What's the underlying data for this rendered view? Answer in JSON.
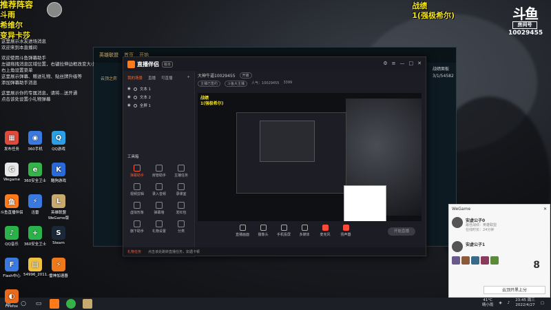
{
  "overlay": {
    "title": "推荐阵容",
    "lines": [
      "斗雨",
      "希维尔",
      "变异卡莎"
    ],
    "top_right": [
      "战绩",
      "1(强极希尔)"
    ]
  },
  "douyu": {
    "logo": "斗鱼",
    "sub": "房间号",
    "room_id": "10029455"
  },
  "chat": [
    "这里展示水友进场消息",
    "欢迎来到本直播间",
    "欢迎使用斗鱼弹幕助手",
    "左键拖拽消息区域位置，右键拉伸边框改变大小",
    "右上角设置菜单",
    "这里展示弹幕、赠送礼物、贴丝牌升级等",
    "添加弹幕助手消息",
    "这里展示你的专属消息，请将...送开通",
    "点击该处设置小礼物弹幕"
  ],
  "desktop_icons": [
    {
      "label": "发布任务",
      "color": "#e04a3a",
      "glyph": "▦"
    },
    {
      "label": "360手机",
      "color": "#3a7ae0",
      "glyph": "◉"
    },
    {
      "label": "QQ游戏",
      "color": "#2aa0e8",
      "glyph": "Q"
    },
    {
      "label": "Wegame",
      "color": "#e8e8e8",
      "glyph": "G"
    },
    {
      "label": "360安全卫士",
      "color": "#35b24a",
      "glyph": "e"
    },
    {
      "label": "酷狗游戏",
      "color": "#2a6ad8",
      "glyph": "K"
    },
    {
      "label": "斗鱼直播伴侣",
      "color": "#ff7a1a",
      "glyph": "鱼"
    },
    {
      "label": "迅雷",
      "color": "#3a7ae0",
      "glyph": "⚡"
    },
    {
      "label": "英雄联盟WeGame版",
      "color": "#c8aa6e",
      "glyph": "L"
    },
    {
      "label": "QQ音乐",
      "color": "#2ab34a",
      "glyph": "♪"
    },
    {
      "label": "360安全卫士",
      "color": "#2ab34a",
      "glyph": "+"
    },
    {
      "label": "Steam",
      "color": "#1b2838",
      "glyph": "S"
    },
    {
      "label": "Flash中心",
      "color": "#3a7ae0",
      "glyph": "F"
    },
    {
      "label": "54996_2011...",
      "color": "#f0c040",
      "glyph": "▤"
    },
    {
      "label": "雷神加速器",
      "color": "#f07a1a",
      "glyph": "⚡"
    },
    {
      "label": "Firefox",
      "color": "#e86a1a",
      "glyph": "◐"
    }
  ],
  "app": {
    "name": "直播伴侣",
    "version": "版本",
    "tabs": [
      "我的场景",
      "直播",
      "可直播"
    ],
    "scenes": [
      "文本 1",
      "文本 2",
      "全屏 1"
    ],
    "tools_title": "工具箱",
    "tools": [
      "弹幕助手",
      "房管助手",
      "主播任务",
      "视频剪辑",
      "录入音频",
      "录课室",
      "虚拟形象",
      "弹幕墙",
      "发红包",
      "旗下助手",
      "礼物设置",
      "分类"
    ],
    "stream_title": "大神牛逼10029455",
    "stream_tag": "开播",
    "stream_sub": [
      "主播已签约",
      "斗鱼大主播",
      "人气：10029455",
      "3399"
    ],
    "bottom_buttons": [
      "直播画面",
      "摄像头",
      "手机投屏",
      "多媒体",
      "麦克风",
      "扬声器"
    ],
    "start_label": "开始直播",
    "status": [
      "礼物任务",
      "点击该处跳转直播任务，如遇卡顿"
    ]
  },
  "preview": {
    "overlay": [
      "战绩",
      "1(强极希尔)"
    ]
  },
  "lol": {
    "tabs": [
      "英雄联盟",
      "首页",
      "开始"
    ],
    "left_label": "云顶之弈"
  },
  "wegame": {
    "title": "WeGame",
    "user_name": "安虚公子0",
    "user_sub": [
      "最佳战绩：英雄联盟",
      "在线时长：24分钟"
    ],
    "user2_name": "安虚公子1",
    "count": "8",
    "button": "云顶开黑上分"
  },
  "taskbar": {
    "weather_temp": "41°C",
    "weather_text": "晴小雨",
    "time": "23:45 周三",
    "date": "2022/4/27"
  },
  "side_text": [
    "战绩面板",
    "3/1/54582"
  ]
}
